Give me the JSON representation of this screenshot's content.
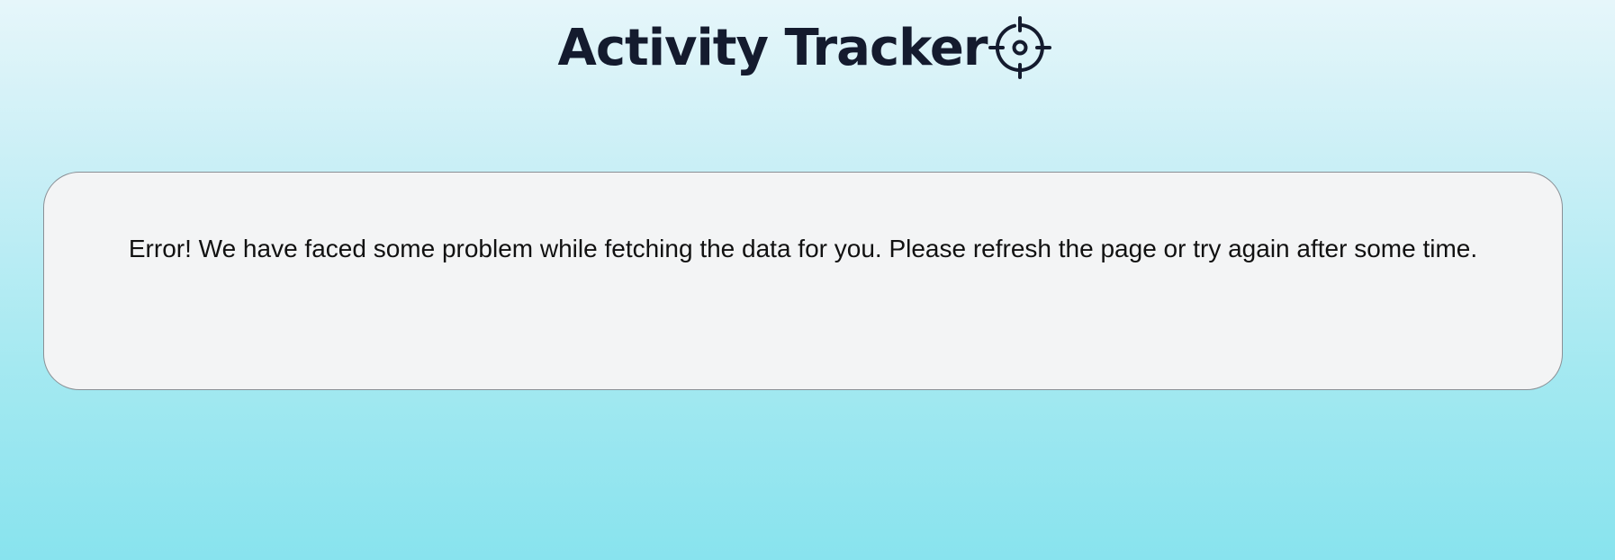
{
  "header": {
    "title": "Activity Tracker",
    "logo_icon": "target-crosshair-icon"
  },
  "error": {
    "message": "Error! We have faced some problem while fetching the data for you. Please refresh the page or try again after some time."
  },
  "colors": {
    "title": "#141b2e",
    "card_background": "#f3f4f5",
    "card_border": "#8a8f95",
    "background_top": "#e6f6fa",
    "background_bottom": "#88e3ee"
  }
}
